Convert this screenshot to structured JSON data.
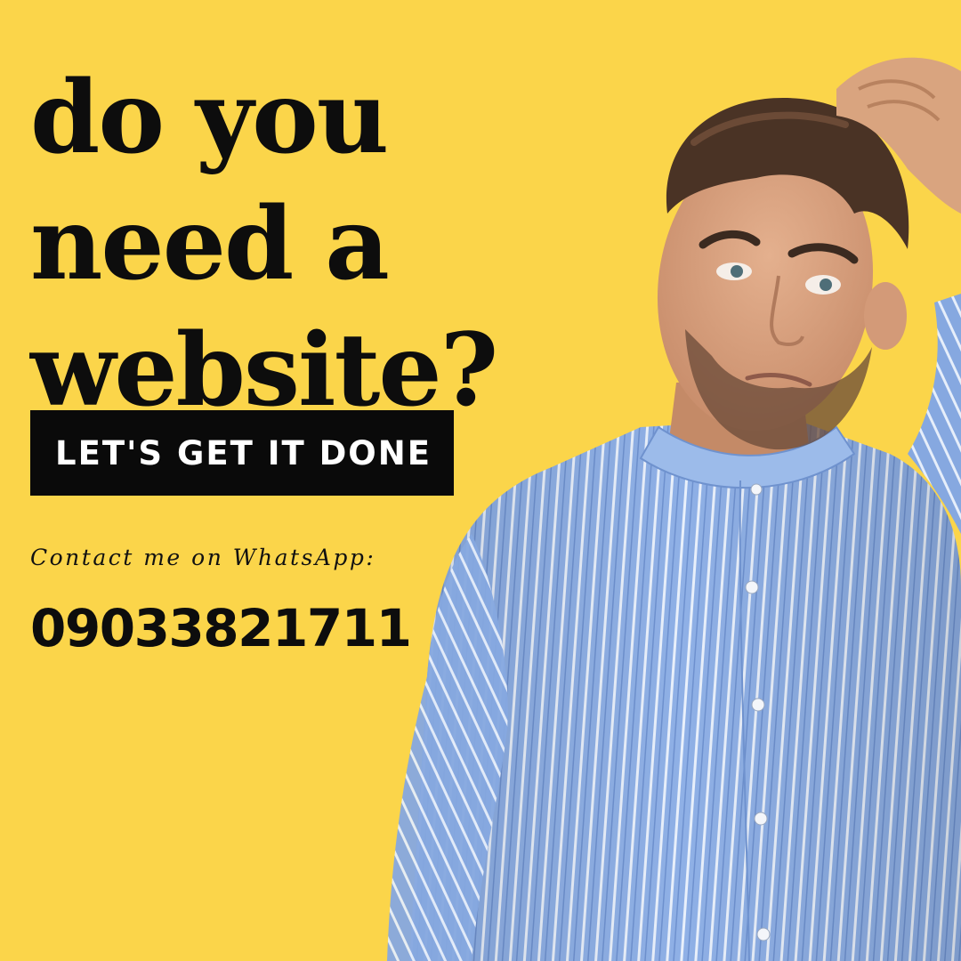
{
  "headline": {
    "line1": "do you",
    "line2": "need a",
    "line3": "website?"
  },
  "cta": {
    "label": "LET'S GET IT DONE"
  },
  "contact": {
    "label": "Contact me on WhatsApp:",
    "phone": "09033821711"
  },
  "colors": {
    "background": "#FBD54A",
    "text": "#0d0d0d",
    "cta_background": "#0a0a0a",
    "cta_text": "#ffffff",
    "shirt": "#8FB0E6"
  },
  "image": {
    "subject": "man-scratching-head-photo"
  }
}
